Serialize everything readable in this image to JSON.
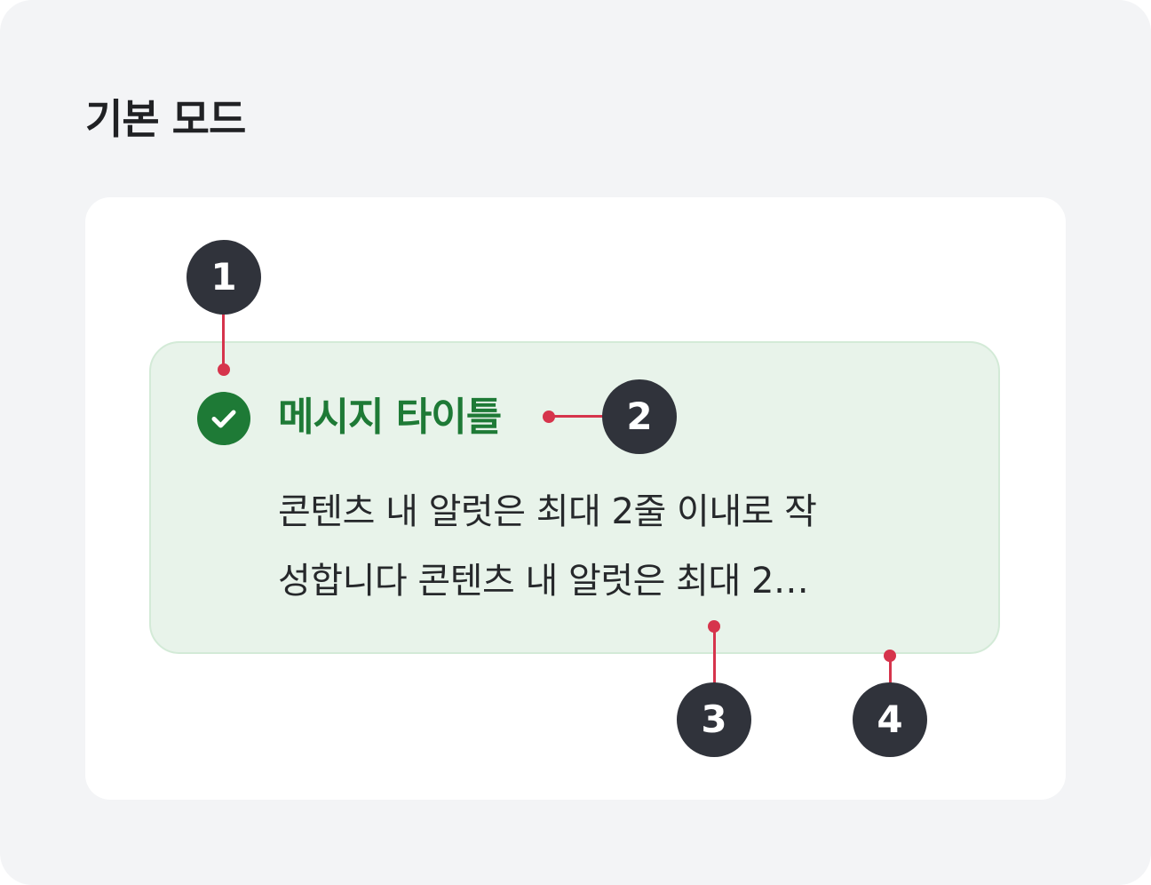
{
  "section": {
    "title": "기본 모드"
  },
  "alert": {
    "icon": "check-circle-icon",
    "title": "메시지 타이틀",
    "body_lines": [
      "콘텐츠 내 알럿은 최대 2줄 이내로 작",
      "성합니다  콘텐츠 내 알럿은 최대 2…"
    ]
  },
  "callouts": [
    {
      "label": "1"
    },
    {
      "label": "2"
    },
    {
      "label": "3"
    },
    {
      "label": "4"
    }
  ],
  "colors": {
    "page_background": "#f3f4f6",
    "alert_background": "#e8f3ea",
    "alert_border": "#d3ead7",
    "success_green": "#1e7a36",
    "callout_badge": "#30333b",
    "callout_line": "#d6344c"
  }
}
